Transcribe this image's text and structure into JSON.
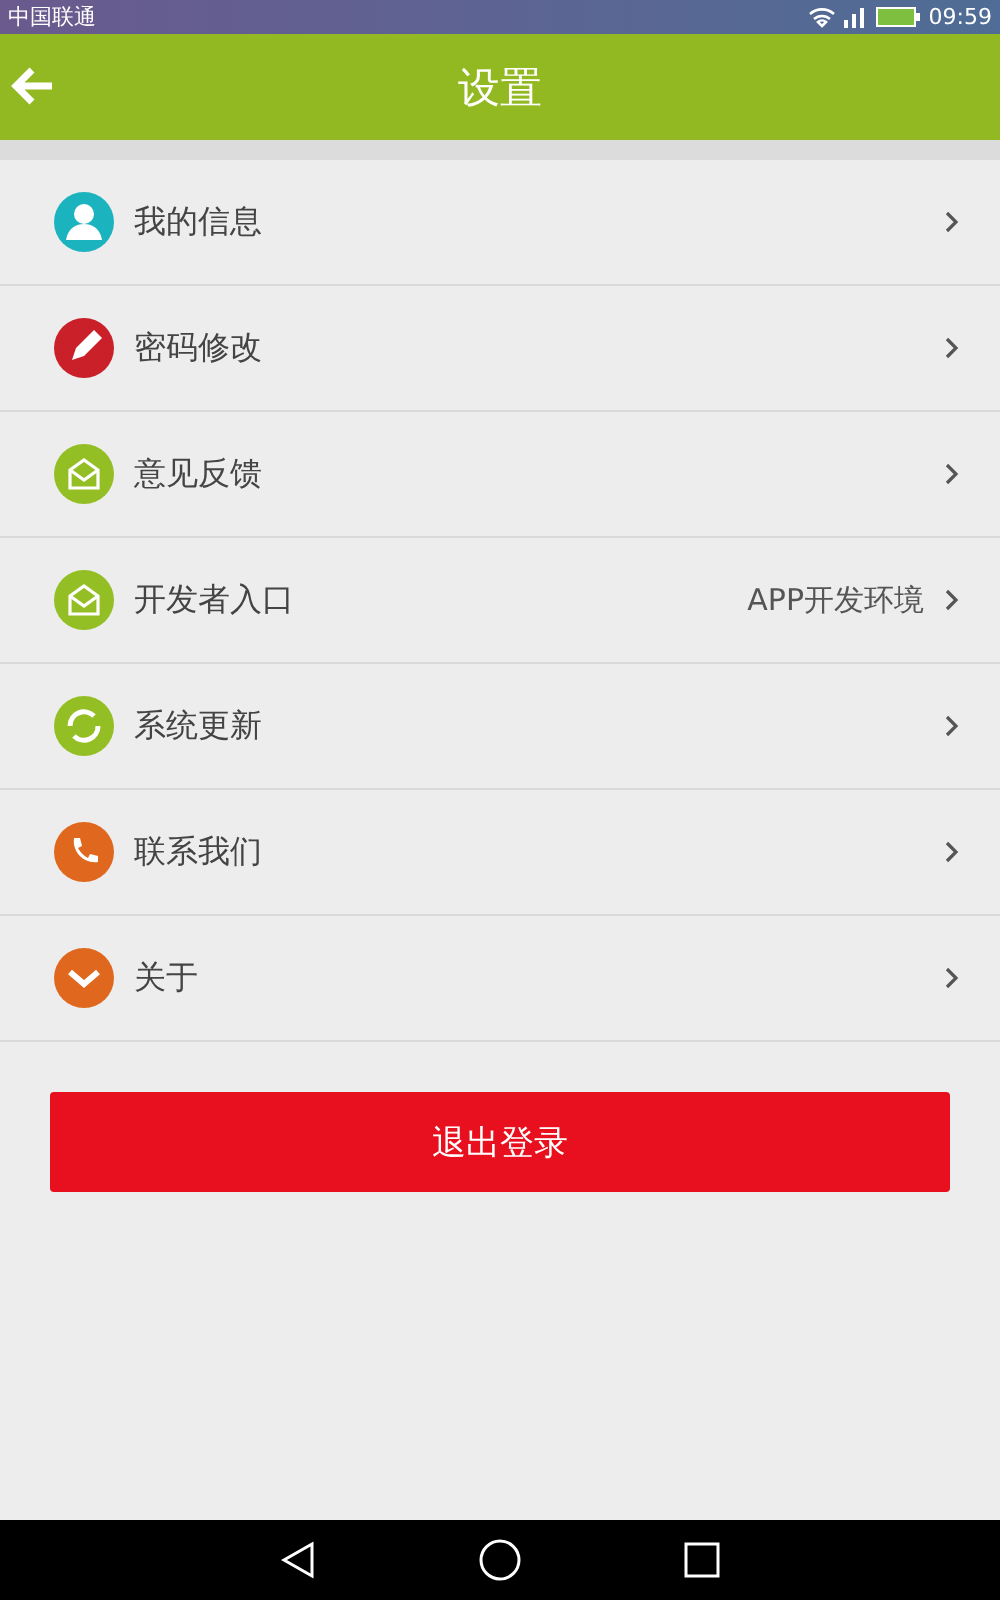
{
  "status_bar": {
    "carrier": "中国联通",
    "time": "09:59"
  },
  "header": {
    "title": "设置"
  },
  "items": [
    {
      "label": "我的信息",
      "kind": "person",
      "color": "#1bb3be"
    },
    {
      "label": "密码修改",
      "kind": "pencil",
      "color": "#c9202a"
    },
    {
      "label": "意见反馈",
      "kind": "mail",
      "color": "#94bf24"
    },
    {
      "label": "开发者入口",
      "kind": "mail",
      "color": "#94bf24",
      "value": "APP开发环境"
    },
    {
      "label": "系统更新",
      "kind": "refresh",
      "color": "#94bf24"
    },
    {
      "label": "联系我们",
      "kind": "phone",
      "color": "#e0681e"
    },
    {
      "label": "关于",
      "kind": "down",
      "color": "#e0681e"
    }
  ],
  "logout": "退出登录"
}
